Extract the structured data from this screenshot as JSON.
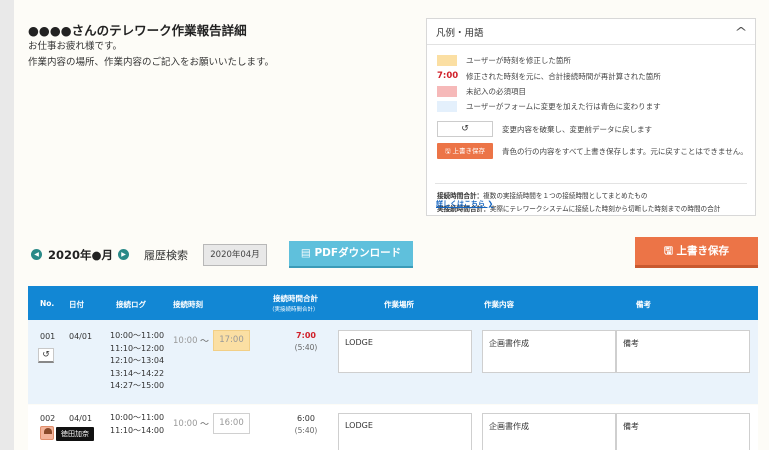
{
  "header": {
    "title": "●●●●さんのテレワーク作業報告詳細",
    "greeting_line1": "お仕事お疲れ様です。",
    "greeting_line2": "作業内容の場所、作業内容のご記入をお願いいたします。"
  },
  "legend": {
    "title": "凡例・用語",
    "toggle_icon": "chevron-up-icon",
    "items": [
      {
        "key_color": "#fbdfa3",
        "text": "ユーザーが時刻を修正した箇所"
      },
      {
        "key_text": "7:00",
        "key_color": "#d0202a",
        "text": "修正された時刻を元に、合計接続時間が再計算された箇所"
      },
      {
        "key_color": "#f6b9b9",
        "text": "未記入の必須項目"
      },
      {
        "key_color": "#e4f0fc",
        "text": "ユーザーがフォームに変更を加えた行は青色に変わります"
      }
    ],
    "undo_key_icon": "undo-icon",
    "undo_desc": "変更内容を破棄し、変更前データに戻します",
    "save_key_label": "上書き保存",
    "save_desc": "青色の行の内容をすべて上書き保存します。元に戻すことはできません。",
    "def1_term": "接続時間合計：",
    "def1_text": "複数の実接続時間を１つの接続時間としてまとめたもの",
    "def2_term": "実接続時間合計：",
    "def2_text": "実際にテレワークシステムに接続した時刻から切断した時刻までの時間の合計",
    "link": "詳しくはこちら ❯"
  },
  "toolbar": {
    "prev_icon": "chevron-left-icon",
    "next_icon": "chevron-right-icon",
    "month": "2020年●月",
    "history_label": "履歴検索",
    "history_value": "2020年04月",
    "pdf_label": "PDFダウンロード",
    "save_label": "上書き保存"
  },
  "table": {
    "columns": {
      "no": "No.",
      "date": "日付",
      "log": "接続ログ",
      "time": "接続時刻",
      "total": "接続時間合計",
      "total_sub": "（実接続時間合計）",
      "place": "作業場所",
      "content": "作業内容",
      "note": "備考"
    },
    "rows": [
      {
        "no": "001",
        "date": "04/01",
        "log": [
          "10:00～11:00",
          "11:10～12:00",
          "12:10～13:04",
          "13:14～14:22",
          "14:27～15:00"
        ],
        "start": "10:00",
        "tilde": "～",
        "end": "17:00",
        "total": "7:00",
        "actual": "(5:40)",
        "place": "LODGE",
        "content": "企画書作成",
        "note": "備考",
        "undo_icon": "undo-icon"
      },
      {
        "no": "002",
        "date": "04/01",
        "log": [
          "10:00～11:00",
          "11:10～14:00"
        ],
        "start": "10:00",
        "tilde": "～",
        "end": "16:00",
        "total": "6:00",
        "actual": "(5:40)",
        "place": "LODGE",
        "content": "企画書作成",
        "note": "備考",
        "avatar_tooltip": "徳田加奈"
      }
    ]
  }
}
